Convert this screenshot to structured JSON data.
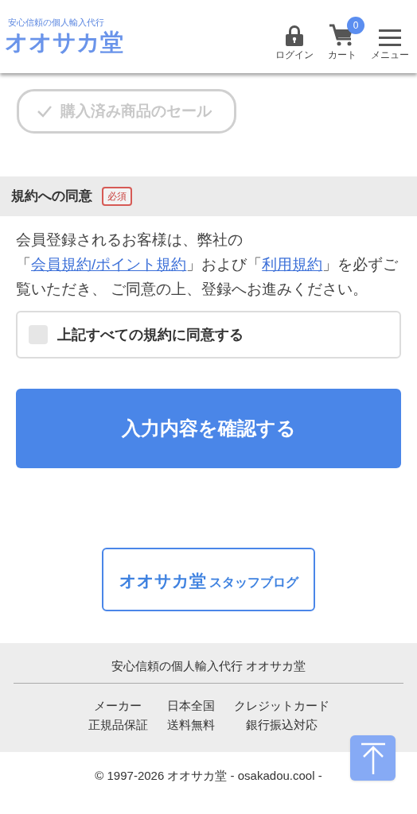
{
  "header": {
    "tagline": "安心信頼の個人輸入代行",
    "logo": "オオサカ堂",
    "actions": [
      {
        "kind": "login",
        "label": "ログイン"
      },
      {
        "kind": "cart",
        "label": "カート",
        "badge": "0"
      },
      {
        "kind": "menu",
        "label": "メニュー"
      }
    ]
  },
  "sale_chip": {
    "label": "購入済み商品のセール",
    "selected": false
  },
  "terms": {
    "title": "規約への同意",
    "required_badge": "必須",
    "paragraph": [
      {
        "kind": "text",
        "text": "会員登録されるお客様は、弊社の「"
      },
      {
        "kind": "link",
        "text": "会員規約/ポイント規約"
      },
      {
        "kind": "text",
        "text": "」および「"
      },
      {
        "kind": "link",
        "text": "利用規約"
      },
      {
        "kind": "text",
        "text": "」を必ずご覧いただき、 ご同意の上、登録へお進みください。"
      }
    ],
    "agree": {
      "label": "上記すべての規約に同意する",
      "checked": false
    }
  },
  "confirm_button": "入力内容を確認する",
  "blog_banner": {
    "brand": "オオサカ堂",
    "label": "スタッフブログ"
  },
  "footer": {
    "tagline": "安心信頼の個人輸入代行 オオサカ堂",
    "features": [
      {
        "lines": [
          "メーカー",
          "正規品保証"
        ]
      },
      {
        "lines": [
          "日本全国",
          "送料無料"
        ]
      },
      {
        "lines": [
          "クレジットカード",
          "銀行振込対応"
        ]
      }
    ],
    "copyright": "© 1997-2026 オオサカ堂 - osakadou.cool -"
  }
}
